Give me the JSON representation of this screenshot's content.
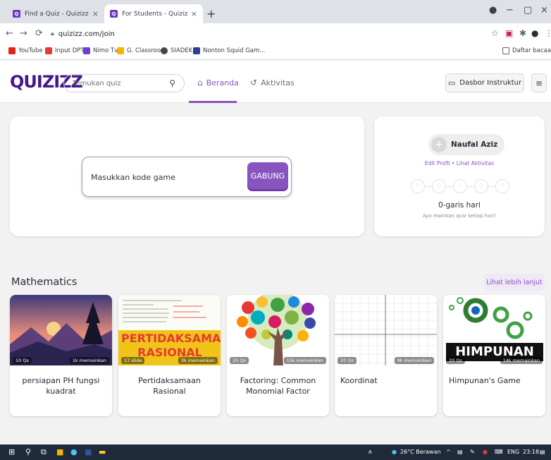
{
  "browser": {
    "tabs": [
      {
        "title": "Find a Quiz - Quizizz",
        "close": "×"
      },
      {
        "title": "For Students - Quizizz",
        "close": "×"
      }
    ],
    "new_tab": "+",
    "window_controls": {
      "minimize": "−",
      "maximize": "▢",
      "close": "×"
    },
    "url": "quizizz.com/join",
    "bookmarks": [
      "YouTube",
      "Input DPT",
      "Nimo Tv",
      "G. Classroom",
      "SIADEK",
      "Nonton Squid Gam..."
    ],
    "reading_list": "Daftar bacaan"
  },
  "header": {
    "logo": "QUIZIZZ",
    "search_placeholder": "Temukan quiz",
    "nav": [
      {
        "label": "Beranda"
      },
      {
        "label": "Aktivitas"
      }
    ],
    "dashboard_button": "Dasbor Instruktur"
  },
  "join": {
    "input_placeholder": "Masukkan kode game",
    "button": "GABUNG"
  },
  "profile": {
    "name": "Naufal Aziz",
    "links": "Edit Profil  •  Lihat Aktivitas",
    "streak_count_text": "0-garis hari",
    "streak_sub": "Ayo mainkan quiz setiap hari!"
  },
  "section": {
    "title": "Mathematics",
    "more_button": "Lihat lebih lanjut",
    "quizzes": [
      {
        "count": "10 Qs",
        "plays": "1k memainkan",
        "title": "persiapan PH fungsi kuadrat"
      },
      {
        "count": "17 slide",
        "plays": "3k memainkan",
        "title": "Pertidaksamaan Rasional",
        "thumb_text": "PERTIDAKSAMAAN RASIONAL"
      },
      {
        "count": "20 Qs",
        "plays": "15k memainkan",
        "title": "Factoring: Common Monomial Factor"
      },
      {
        "count": "20 Qs",
        "plays": "9k memainkan",
        "title": "Koordinat"
      },
      {
        "count": "20 Qs",
        "plays": "14k memainkan",
        "title": "Himpunan's Game",
        "thumb_text": "HIMPUNAN"
      }
    ]
  },
  "taskbar": {
    "weather": "26°C Berawan",
    "lang": "ENG",
    "time": "23:18"
  }
}
